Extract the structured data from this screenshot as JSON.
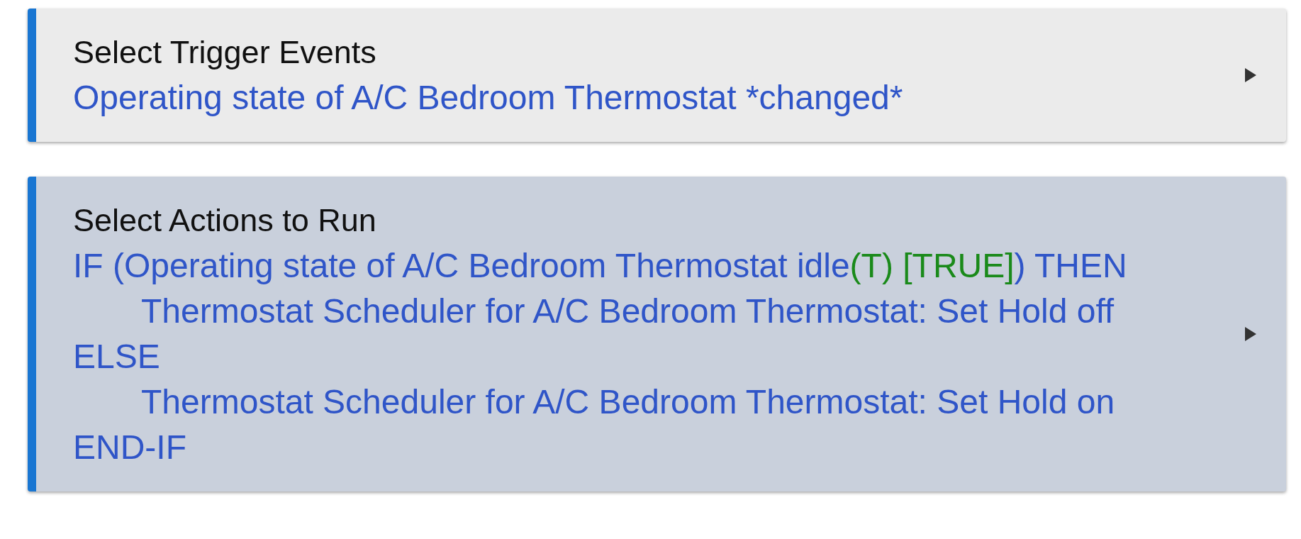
{
  "cards": [
    {
      "title": "Select Trigger Events",
      "selected": false,
      "lines": [
        {
          "segments": [
            {
              "text": "Operating state of A/C Bedroom Thermostat *changed*",
              "kind": "plain"
            }
          ]
        }
      ]
    },
    {
      "title": "Select Actions to Run",
      "selected": true,
      "lines": [
        {
          "segments": [
            {
              "text": "IF (Operating state of A/C Bedroom Thermostat idle",
              "kind": "plain"
            },
            {
              "text": "(T) [TRUE]",
              "kind": "result"
            },
            {
              "text": ") THEN",
              "kind": "plain"
            }
          ],
          "children": [
            {
              "segments": [
                {
                  "text": "Thermostat Scheduler for A/C Bedroom Thermostat: Set Hold off",
                  "kind": "plain"
                }
              ]
            }
          ]
        },
        {
          "segments": [
            {
              "text": "ELSE",
              "kind": "plain"
            }
          ],
          "children": [
            {
              "segments": [
                {
                  "text": "Thermostat Scheduler for A/C Bedroom Thermostat: Set Hold on",
                  "kind": "plain"
                }
              ]
            }
          ]
        },
        {
          "segments": [
            {
              "text": "END-IF",
              "kind": "plain"
            }
          ]
        }
      ]
    }
  ]
}
